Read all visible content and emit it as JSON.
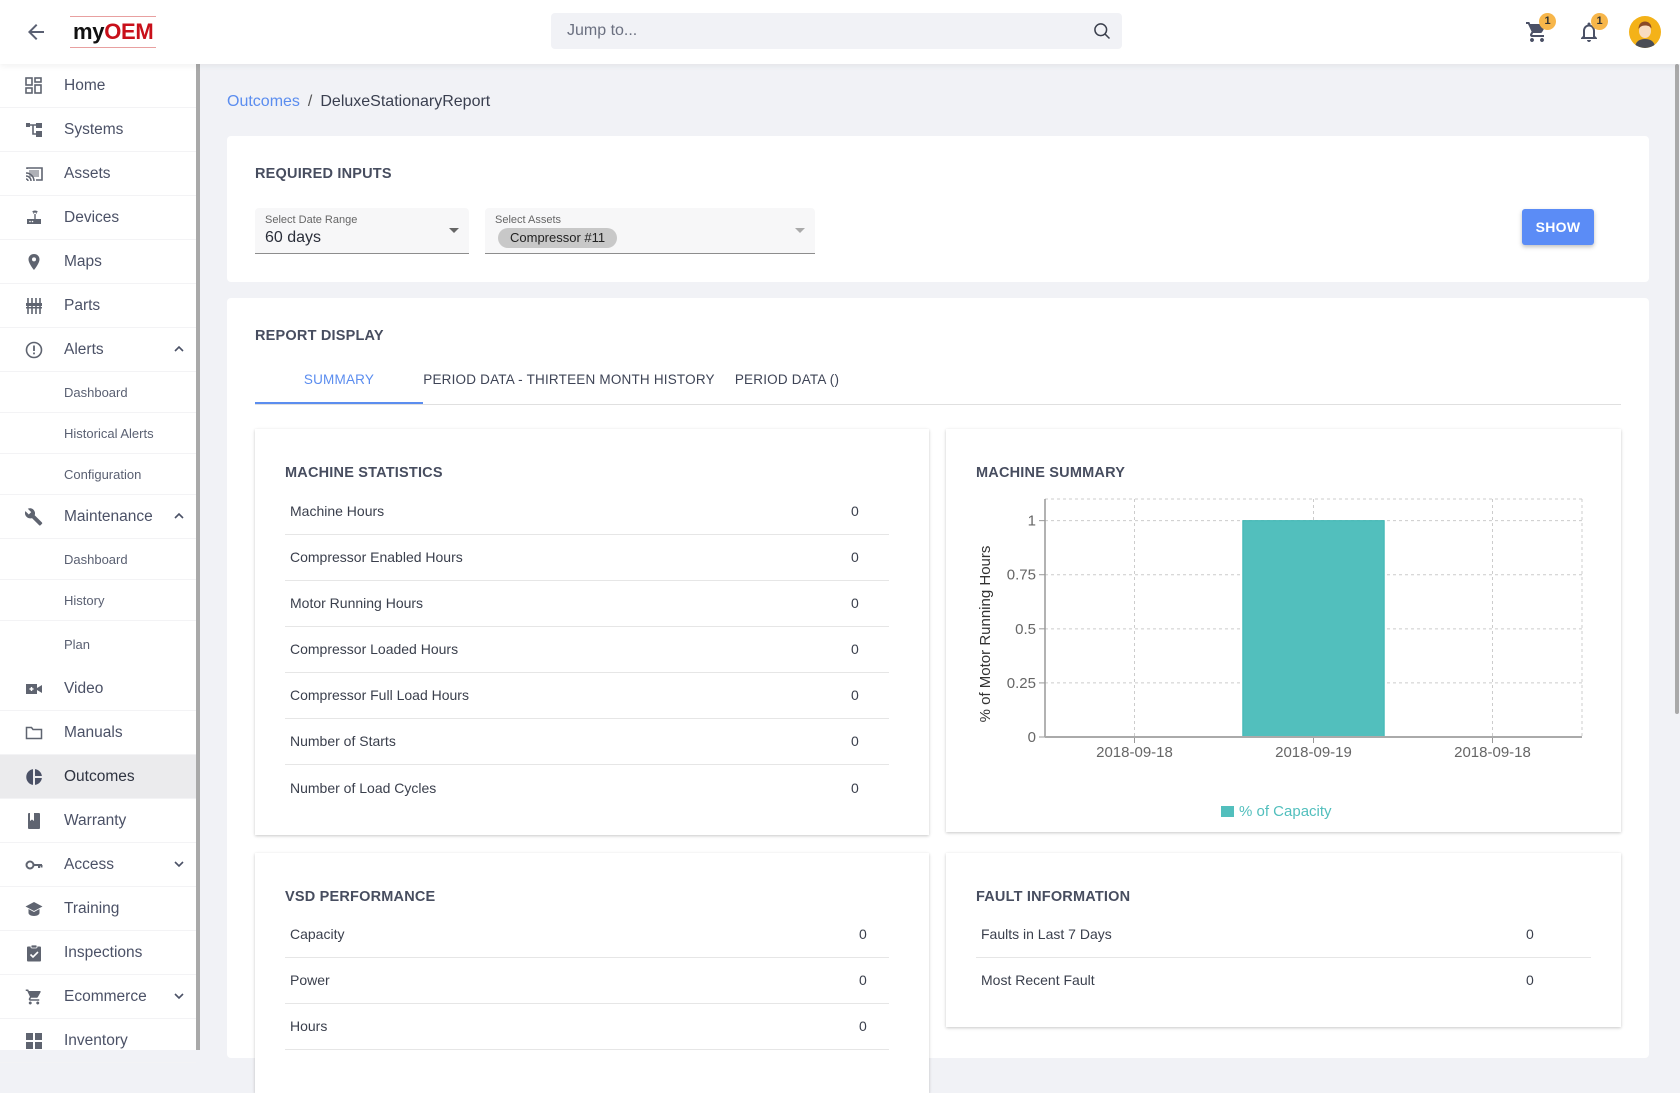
{
  "header": {
    "logo_my": "my",
    "logo_oem": "OEM",
    "search_placeholder": "Jump to...",
    "cart_badge": "1",
    "notifications_badge": "1"
  },
  "sidebar": {
    "items": [
      {
        "label": "Home",
        "icon": "dashboard-grid-icon"
      },
      {
        "label": "Systems",
        "icon": "hierarchy-icon"
      },
      {
        "label": "Assets",
        "icon": "cast-icon"
      },
      {
        "label": "Devices",
        "icon": "router-icon"
      },
      {
        "label": "Maps",
        "icon": "map-pin-icon"
      },
      {
        "label": "Parts",
        "icon": "sliders-icon"
      },
      {
        "label": "Alerts",
        "icon": "alert-circle-icon",
        "expanded": true,
        "children": [
          "Dashboard",
          "Historical Alerts",
          "Configuration"
        ]
      },
      {
        "label": "Maintenance",
        "icon": "wrench-icon",
        "expanded": true,
        "children": [
          "Dashboard",
          "History",
          "Plan"
        ]
      },
      {
        "label": "Video",
        "icon": "video-icon"
      },
      {
        "label": "Manuals",
        "icon": "folder-icon"
      },
      {
        "label": "Outcomes",
        "icon": "pie-chart-icon",
        "active": true
      },
      {
        "label": "Warranty",
        "icon": "book-icon"
      },
      {
        "label": "Access",
        "icon": "key-icon",
        "expanded": false
      },
      {
        "label": "Training",
        "icon": "graduation-cap-icon"
      },
      {
        "label": "Inspections",
        "icon": "clipboard-check-icon"
      },
      {
        "label": "Ecommerce",
        "icon": "cart-icon",
        "expanded": false
      },
      {
        "label": "Inventory",
        "icon": "inventory-icon"
      }
    ]
  },
  "breadcrumb": {
    "parent": "Outcomes",
    "separator": "/",
    "current": "DeluxeStationaryReport"
  },
  "required_inputs": {
    "title": "REQUIRED INPUTS",
    "date_range_label": "Select Date Range",
    "date_range_value": "60 days",
    "assets_label": "Select Assets",
    "assets_chip": "Compressor #11",
    "show_button": "SHOW"
  },
  "report_display": {
    "title": "REPORT DISPLAY",
    "tabs": [
      {
        "label": "SUMMARY",
        "active": true
      },
      {
        "label": "PERIOD DATA - THIRTEEN MONTH HISTORY",
        "active": false
      },
      {
        "label": "PERIOD DATA ()",
        "active": false
      }
    ]
  },
  "machine_statistics": {
    "title": "MACHINE STATISTICS",
    "rows": [
      {
        "label": "Machine Hours",
        "value": "0"
      },
      {
        "label": "Compressor Enabled Hours",
        "value": "0"
      },
      {
        "label": "Motor Running Hours",
        "value": "0"
      },
      {
        "label": "Compressor Loaded Hours",
        "value": "0"
      },
      {
        "label": "Compressor Full Load Hours",
        "value": "0"
      },
      {
        "label": "Number of Starts",
        "value": "0"
      },
      {
        "label": "Number of Load Cycles",
        "value": "0"
      }
    ]
  },
  "machine_summary": {
    "title": "MACHINE SUMMARY"
  },
  "vsd_performance": {
    "title": "VSD PERFORMANCE",
    "rows": [
      {
        "label": "Capacity",
        "value": "0"
      },
      {
        "label": "Power",
        "value": "0"
      },
      {
        "label": "Hours",
        "value": "0"
      }
    ]
  },
  "fault_information": {
    "title": "FAULT INFORMATION",
    "rows": [
      {
        "label": "Faults in Last 7 Days",
        "value": "0"
      },
      {
        "label": "Most Recent Fault",
        "value": "0"
      }
    ]
  },
  "chart_data": {
    "type": "bar",
    "title": "",
    "categories": [
      "2018-09-18",
      "2018-09-19",
      "2018-09-18"
    ],
    "series": [
      {
        "name": "% of Capacity",
        "values": [
          0,
          1,
          0
        ],
        "color": "#52bfbd"
      }
    ],
    "xlabel": "",
    "ylabel": "% of Motor Running Hours",
    "ylim": [
      0,
      1.1
    ],
    "yticks": [
      0,
      0.25,
      0.5,
      0.75,
      1
    ],
    "ytick_labels": [
      "0",
      "0.25",
      "0.5",
      "0.75",
      "1"
    ],
    "grid": true,
    "legend": "bottom-center"
  },
  "colors": {
    "accent": "#5b8def",
    "button": "#5b8cf6",
    "badge": "#f7b64a",
    "bar": "#52bfbd",
    "logo_red": "#c8101a"
  }
}
